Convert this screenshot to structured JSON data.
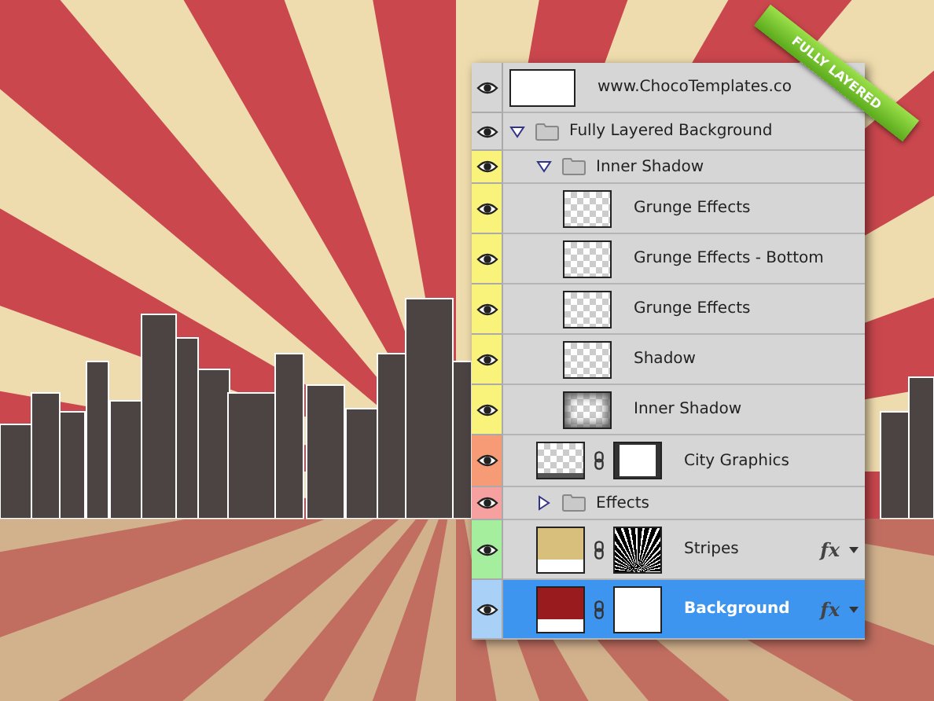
{
  "banner": "FULLY LAYERED",
  "layers": [
    {
      "name": "www.ChocoTemplates.co",
      "kind": "text",
      "visible": true,
      "selected": false
    },
    {
      "name": "Fully Layered Background",
      "kind": "folder",
      "visible": true,
      "selected": false,
      "expanded": true,
      "children": [
        {
          "name": "Inner Shadow",
          "kind": "folder",
          "visible": true,
          "selected": false,
          "color": "#f9f37c",
          "expanded": true,
          "children": [
            {
              "name": "Grunge Effects",
              "kind": "transparent-layer",
              "visible": true,
              "selected": false,
              "color": "#f9f37c"
            },
            {
              "name": "Grunge Effects - Bottom",
              "kind": "transparent-layer",
              "visible": true,
              "selected": false,
              "color": "#f9f37c"
            },
            {
              "name": "Grunge Effects",
              "kind": "transparent-layer",
              "visible": true,
              "selected": false,
              "color": "#f9f37c"
            },
            {
              "name": "Shadow",
              "kind": "transparent-layer",
              "visible": true,
              "selected": false,
              "color": "#f9f37c"
            },
            {
              "name": "Inner Shadow",
              "kind": "vignette-layer",
              "visible": true,
              "selected": false,
              "color": "#f9f37c"
            }
          ]
        },
        {
          "name": "City Graphics",
          "kind": "masked-layer",
          "visible": true,
          "selected": false,
          "color": "#f79b77"
        },
        {
          "name": "Effects",
          "kind": "folder",
          "visible": true,
          "selected": false,
          "color": "#f6a0a0",
          "expanded": false
        },
        {
          "name": "Stripes",
          "kind": "pattern-fill",
          "fx": "fx",
          "visible": true,
          "selected": false,
          "color": "#a4ee9e"
        },
        {
          "name": "Background",
          "kind": "solid-fill",
          "fx": "fx",
          "visible": true,
          "selected": true,
          "color": "#a9d1f7"
        }
      ]
    }
  ]
}
